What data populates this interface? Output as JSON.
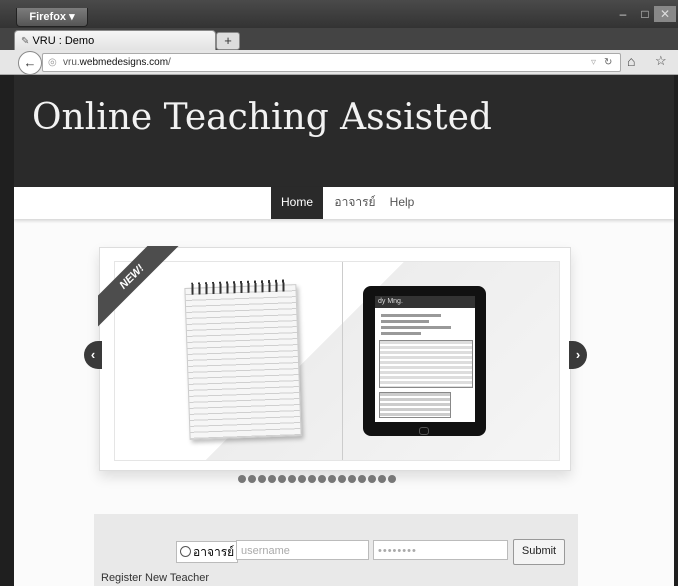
{
  "browser": {
    "app_button": "Firefox ▾",
    "tab_title": "VRU : Demo",
    "new_tab": "+",
    "url_prefix": "vru.",
    "url_domain": "webmedesigns.com",
    "url_suffix": "/",
    "min": "–",
    "max": "□",
    "close": "✕",
    "back": "←",
    "home_icon": "⌂",
    "bookmark_icon": "☆"
  },
  "header": {
    "title": "Online Teaching Assisted"
  },
  "nav": {
    "items": [
      "Home",
      "อาจารย์",
      "Help"
    ]
  },
  "slider": {
    "ribbon": "NEW!",
    "tablet_title": "dy Mng.",
    "prev": "‹",
    "next": "›",
    "dot_count": 16
  },
  "login": {
    "role_label": "อาจารย์",
    "username_placeholder": "username",
    "password_value": "••••••••",
    "submit_label": "Submit",
    "register_link": "Register New Teacher"
  }
}
